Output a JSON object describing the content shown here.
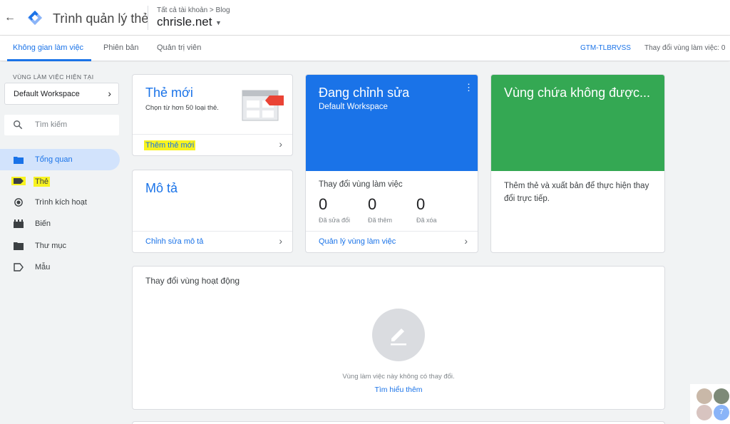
{
  "app": {
    "title": "Trình quản lý thẻ",
    "breadcrumb": "Tất cả tài khoản > Blog",
    "container_name": "chrisle.net"
  },
  "tabs": [
    {
      "label": "Không gian làm việc",
      "active": true
    },
    {
      "label": "Phiên bản",
      "active": false
    },
    {
      "label": "Quản trị viên",
      "active": false
    }
  ],
  "header_right": {
    "container_id": "GTM-TLBRVSS",
    "workspace_changes": "Thay đổi vùng làm việc: 0"
  },
  "sidebar": {
    "workspace_label": "VÙNG LÀM VIỆC HIỆN TẠI",
    "workspace_name": "Default Workspace",
    "search_placeholder": "Tìm kiếm",
    "items": [
      {
        "label": "Tổng quan",
        "icon": "folder-icon",
        "active": true
      },
      {
        "label": "Thẻ",
        "icon": "tag-icon",
        "active": false
      },
      {
        "label": "Trình kích hoạt",
        "icon": "trigger-icon",
        "active": false
      },
      {
        "label": "Biến",
        "icon": "variable-icon",
        "active": false
      },
      {
        "label": "Thư mục",
        "icon": "folder-icon",
        "active": false
      },
      {
        "label": "Mẫu",
        "icon": "template-icon",
        "active": false
      }
    ]
  },
  "cards": {
    "new_tag": {
      "title": "Thẻ mới",
      "subtitle": "Chọn từ hơn 50 loại thẻ.",
      "link": "Thêm thẻ mới"
    },
    "description": {
      "title": "Mô tả",
      "link": "Chỉnh sửa mô tả"
    },
    "editing": {
      "title": "Đang chỉnh sửa",
      "subtitle": "Default Workspace",
      "section_title": "Thay đổi vùng làm việc",
      "stats": [
        {
          "value": "0",
          "label": "Đã sửa đổi"
        },
        {
          "value": "0",
          "label": "Đã thêm"
        },
        {
          "value": "0",
          "label": "Đã xóa"
        }
      ],
      "link": "Quản lý vùng làm việc"
    },
    "container": {
      "title": "Vùng chứa không được...",
      "body": "Thêm thẻ và xuất bản để thực hiện thay đổi trực tiếp."
    },
    "activity": {
      "title": "Thay đổi vùng hoạt động",
      "empty_text": "Vùng làm việc này không có thay đổi.",
      "learn_more": "Tìm hiểu thêm"
    }
  },
  "avatar_badge": "7",
  "colors": {
    "accent": "#1a73e8",
    "green": "#34a853",
    "highlight": "#f8f31f",
    "red_tag": "#ea4335"
  }
}
